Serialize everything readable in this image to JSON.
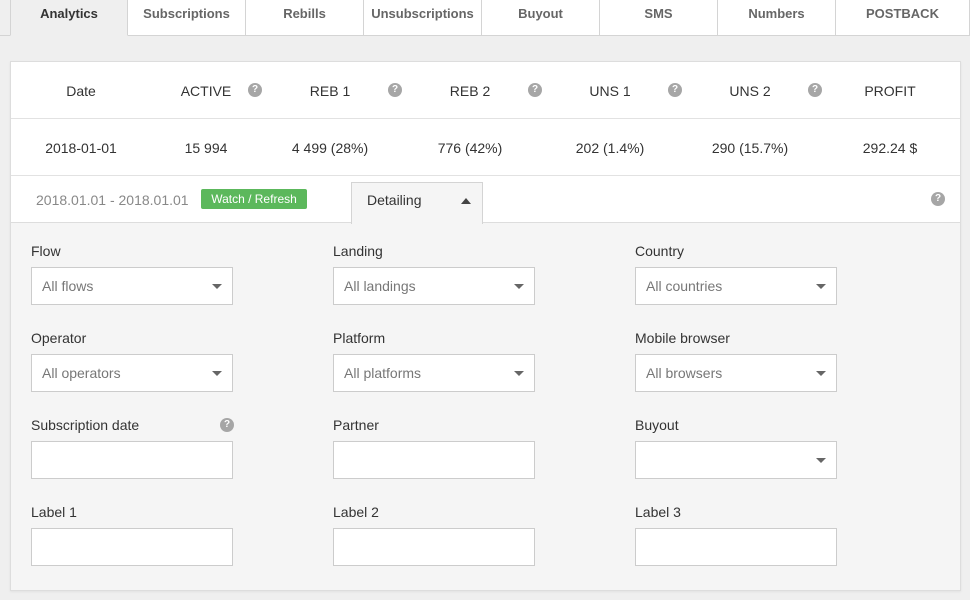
{
  "tabs": [
    {
      "label": "Analytics"
    },
    {
      "label": "Subscriptions"
    },
    {
      "label": "Rebills"
    },
    {
      "label": "Unsubscriptions"
    },
    {
      "label": "Buyout"
    },
    {
      "label": "SMS"
    },
    {
      "label": "Numbers"
    },
    {
      "label": "POSTBACK"
    }
  ],
  "stats": {
    "headers": {
      "date": "Date",
      "active": "ACTIVE",
      "reb1": "REB 1",
      "reb2": "REB 2",
      "uns1": "UNS 1",
      "uns2": "UNS 2",
      "profit": "PROFIT"
    },
    "row": {
      "date": "2018-01-01",
      "active": "15 994",
      "reb1": "4 499 (28%)",
      "reb2": "776 (42%)",
      "uns1": "202 (1.4%)",
      "uns2": "290 (15.7%)",
      "profit": "292.24 $"
    },
    "help_glyph": "?"
  },
  "toolbar": {
    "date_range": "2018.01.01 - 2018.01.01",
    "watch_label": "Watch / Refresh",
    "detailing_label": "Detailing",
    "accent_green": "#5cb85c"
  },
  "filters": {
    "flow": {
      "label": "Flow",
      "value": "All flows"
    },
    "landing": {
      "label": "Landing",
      "value": "All landings"
    },
    "country": {
      "label": "Country",
      "value": "All countries"
    },
    "operator": {
      "label": "Operator",
      "value": "All operators"
    },
    "platform": {
      "label": "Platform",
      "value": "All platforms"
    },
    "mobile_browser": {
      "label": "Mobile browser",
      "value": "All browsers"
    },
    "subscription_date": {
      "label": "Subscription date",
      "value": ""
    },
    "partner": {
      "label": "Partner",
      "value": ""
    },
    "buyout": {
      "label": "Buyout",
      "value": ""
    },
    "label1": {
      "label": "Label 1",
      "value": ""
    },
    "label2": {
      "label": "Label 2",
      "value": ""
    },
    "label3": {
      "label": "Label 3",
      "value": ""
    }
  }
}
